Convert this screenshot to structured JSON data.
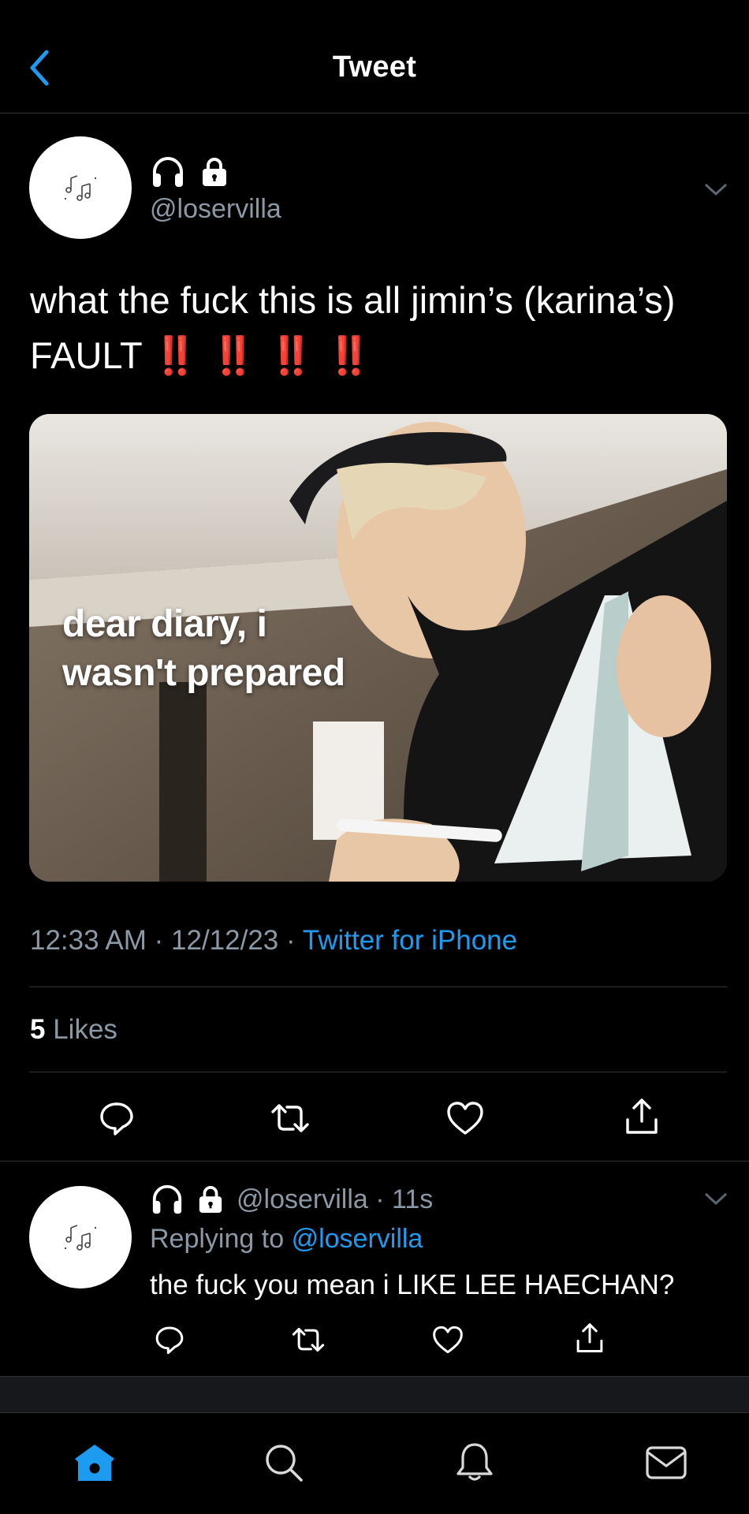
{
  "header": {
    "title": "Tweet",
    "back_icon": "chevron-left-icon"
  },
  "tweet": {
    "author_icons": [
      "headphones-icon",
      "lock-icon"
    ],
    "handle": "@loservilla",
    "text_main": "what the fuck this is all jimin’s (karina’s) FAULT",
    "text_bangs": "‼️ ‼️ ‼️ ‼️",
    "media_caption_line1": "dear diary, i",
    "media_caption_line2": "wasn't prepared",
    "time": "12:33 AM",
    "date": "12/12/23",
    "source": "Twitter for iPhone",
    "likes_count": "5",
    "likes_label": "Likes",
    "actions": [
      "comment-icon",
      "retweet-icon",
      "heart-icon",
      "share-icon"
    ]
  },
  "reply": {
    "handle": "@loservilla",
    "age": "11s",
    "replying_prefix": "Replying to",
    "replying_to": "@loservilla",
    "text": "the fuck you mean i LIKE LEE HAECHAN?"
  },
  "tabbar": {
    "items": [
      "home-icon",
      "search-icon",
      "notifications-bell-icon",
      "messages-envelope-icon"
    ]
  },
  "colors": {
    "accent": "#1d9bf0",
    "background": "#000000",
    "muted": "#8b98a5",
    "alert": "#ff2d2d"
  }
}
